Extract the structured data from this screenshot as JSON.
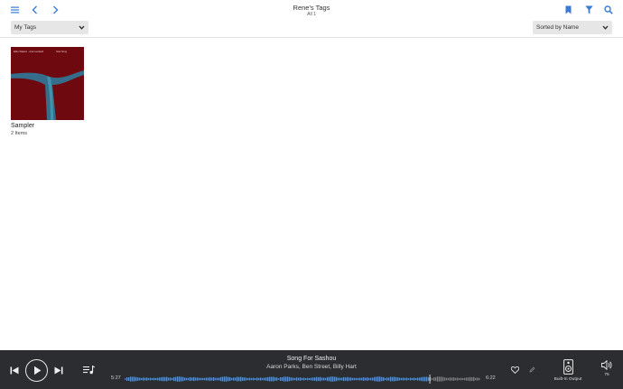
{
  "header": {
    "title": "Rene's Tags",
    "subtitle": "All 1"
  },
  "toolbar": {
    "tags_select": "My Tags",
    "sort_select": "Sorted by Name"
  },
  "tags": [
    {
      "name": "Sampler",
      "count": "2 Items",
      "cover_text_left": "Ellen Watson · Ana Loudwell",
      "cover_text_right": "Soul Song"
    }
  ],
  "player": {
    "track_title": "Song For Sashou",
    "artists": "Aaron Parks, Ben Street, Billy Hart",
    "elapsed": "5:27",
    "total": "6:22",
    "progress": 0.857,
    "output_label": "Built-In Output",
    "volume": "75"
  },
  "colors": {
    "accent": "#3a7bd5",
    "player_bg": "#2c2d30",
    "cover_red": "#7a0c12",
    "cover_blue": "#2c7fa0"
  },
  "icons": {
    "menu": "hamburger-icon",
    "back": "chevron-left-icon",
    "forward": "chevron-right-icon",
    "bookmark": "bookmark-icon",
    "filter": "filter-icon",
    "search": "search-icon"
  }
}
